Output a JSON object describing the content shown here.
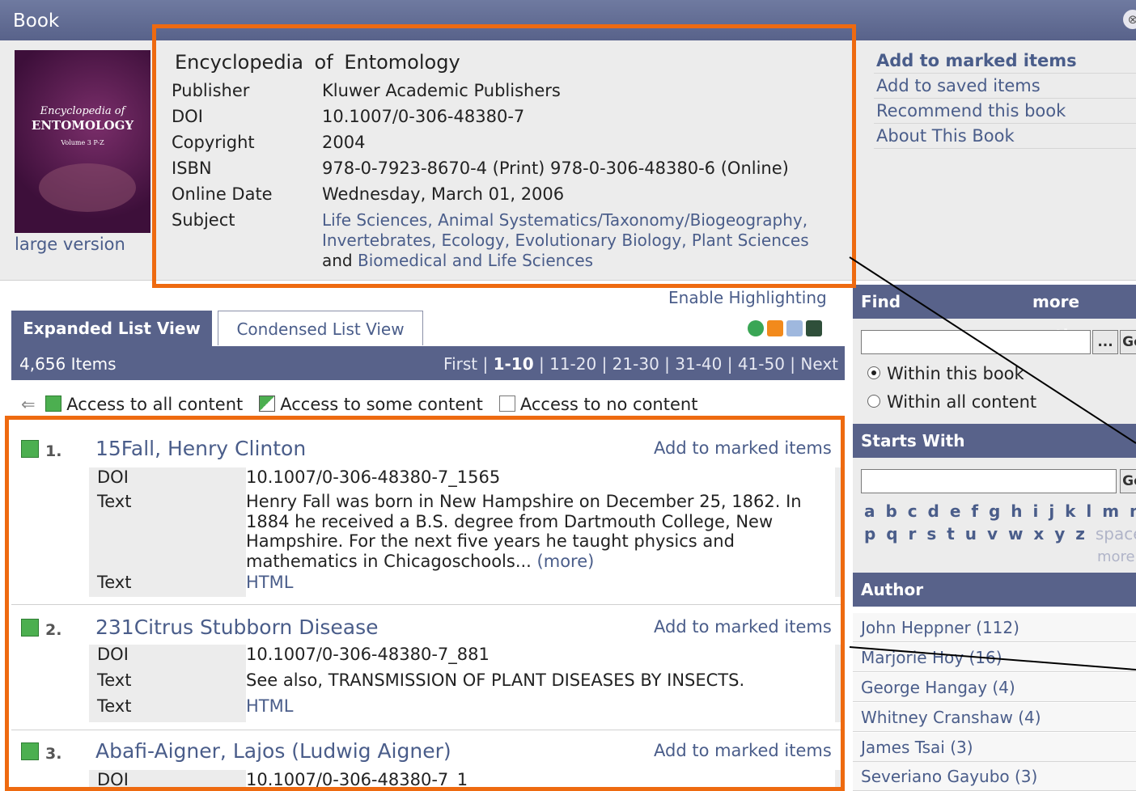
{
  "header": {
    "title": "Book"
  },
  "book": {
    "title": "Encyclopedia of Entomology",
    "large_version": "large version",
    "cover_line1": "Encyclopedia of",
    "cover_line2": "ENTOMOLOGY",
    "cover_line3": "Volume 3 P-Z",
    "fields": [
      {
        "key": "Publisher",
        "value": "Kluwer Academic Publishers"
      },
      {
        "key": "DOI",
        "value": "10.1007/0-306-48380-7"
      },
      {
        "key": "Copyright",
        "value": "2004"
      },
      {
        "key": "ISBN",
        "value": "978-0-7923-8670-4 (Print) 978-0-306-48380-6 (Online)"
      },
      {
        "key": "Online Date",
        "value": "Wednesday, March 01, 2006"
      }
    ],
    "subject_label": "Subject",
    "subjects": [
      "Life Sciences",
      "Animal Systematics/Taxonomy/Biogeography",
      "Invertebrates",
      "Ecology",
      "Evolutionary Biology",
      "Plant Sciences",
      "Biomedical and Life Sciences"
    ],
    "subject_line1": "Life Sciences, Animal Systematics/Taxonomy/Biogeography,",
    "subject_line2": "Invertebrates, Ecology, Evolutionary Biology, Plant Sciences",
    "subject_line3_and": "and",
    "subject_line3": "Biomedical and Life Sciences"
  },
  "actions": [
    "Add to marked items",
    "Add to saved items",
    "Recommend this book",
    "About This Book"
  ],
  "list": {
    "enable_highlighting": "Enable Highlighting",
    "tab_expanded": "Expanded List View",
    "tab_condensed": "Condensed List View",
    "items_count": "4,656 Items",
    "pager": {
      "first": "First",
      "current": "1-10",
      "pages": [
        "11-20",
        "21-30",
        "31-40",
        "41-50"
      ],
      "next": "Next"
    },
    "legend": {
      "all": "Access to all content",
      "some": "Access to some content",
      "none": "Access to no content"
    }
  },
  "results": [
    {
      "num": "1.",
      "title": "15Fall, Henry Clinton",
      "add": "Add to marked items",
      "doi_label": "DOI",
      "doi": "10.1007/0-306-48380-7_1565",
      "text_label": "Text",
      "text_lines": [
        "Henry Fall was born in New Hampshire on December 25, 1862. In",
        "1884 he received a B.S. degree from Dartmouth College, New",
        "Hampshire. For the next five years he taught physics and",
        "mathematics in Chicagoschools..."
      ],
      "more": "(more)",
      "html_label": "Text",
      "html": "HTML"
    },
    {
      "num": "2.",
      "title": "231Citrus Stubborn Disease",
      "add": "Add to marked items",
      "doi_label": "DOI",
      "doi": "10.1007/0-306-48380-7_881",
      "text_label": "Text",
      "text": "See also, TRANSMISSION OF PLANT DISEASES BY INSECTS.",
      "html_label": "Text",
      "html": "HTML"
    },
    {
      "num": "3.",
      "title": "Abafi-Aigner, Lajos (Ludwig Aigner)",
      "add": "Add to marked items",
      "doi_label": "DOI",
      "doi": "10.1007/0-306-48380-7_1"
    }
  ],
  "sidebar": {
    "find": {
      "title": "Find",
      "more": "more options",
      "button": "Go",
      "browse": "...",
      "radio1": "Within this book",
      "radio2": "Within all content"
    },
    "starts_with": {
      "title": "Starts With",
      "button": "Go",
      "letters1": "a b c d e f g h i j k l m n o",
      "letters2": "p q r s t u v w x y z",
      "space": "space",
      "more": "more"
    },
    "author": {
      "title": "Author",
      "items": [
        "John Heppner (112)",
        "Marjorie Hoy (16)",
        "George Hangay (4)",
        "Whitney Cranshaw (4)",
        "James Tsai (3)",
        "Severiano Gayubo (3)"
      ]
    }
  },
  "colors": {
    "accent": "#58628a",
    "highlight": "#ee6a10",
    "link": "#4a5d8a",
    "access_green": "#4caf50"
  }
}
